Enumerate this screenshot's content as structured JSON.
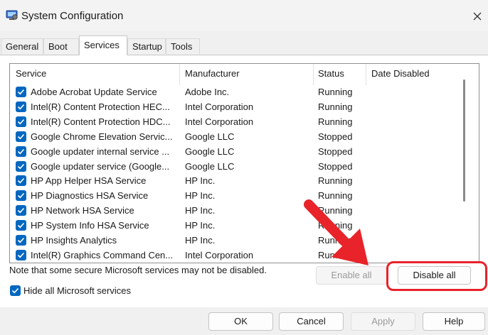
{
  "window": {
    "title": "System Configuration",
    "app_icon": "msconfig-icon",
    "close_icon": "close-icon"
  },
  "tabs": [
    {
      "label": "General",
      "active": false
    },
    {
      "label": "Boot",
      "active": false
    },
    {
      "label": "Services",
      "active": true
    },
    {
      "label": "Startup",
      "active": false
    },
    {
      "label": "Tools",
      "active": false
    }
  ],
  "services": {
    "columns": [
      "Service",
      "Manufacturer",
      "Status",
      "Date Disabled"
    ],
    "rows": [
      {
        "service": "Adobe Acrobat Update Service",
        "manufacturer": "Adobe Inc.",
        "status": "Running",
        "checked": true
      },
      {
        "service": "Intel(R) Content Protection HEC...",
        "manufacturer": "Intel Corporation",
        "status": "Running",
        "checked": true
      },
      {
        "service": "Intel(R) Content Protection HDC...",
        "manufacturer": "Intel Corporation",
        "status": "Running",
        "checked": true
      },
      {
        "service": "Google Chrome Elevation Servic...",
        "manufacturer": "Google LLC",
        "status": "Stopped",
        "checked": true
      },
      {
        "service": "Google updater internal service ...",
        "manufacturer": "Google LLC",
        "status": "Stopped",
        "checked": true
      },
      {
        "service": "Google updater service (Google...",
        "manufacturer": "Google LLC",
        "status": "Stopped",
        "checked": true
      },
      {
        "service": "HP App Helper HSA Service",
        "manufacturer": "HP Inc.",
        "status": "Running",
        "checked": true
      },
      {
        "service": "HP Diagnostics HSA Service",
        "manufacturer": "HP Inc.",
        "status": "Running",
        "checked": true
      },
      {
        "service": "HP Network HSA Service",
        "manufacturer": "HP Inc.",
        "status": "Running",
        "checked": true
      },
      {
        "service": "HP System Info HSA Service",
        "manufacturer": "HP Inc.",
        "status": "Running",
        "checked": true
      },
      {
        "service": "HP Insights Analytics",
        "manufacturer": "HP Inc.",
        "status": "Running",
        "checked": true
      },
      {
        "service": "Intel(R) Graphics Command Cen...",
        "manufacturer": "Intel Corporation",
        "status": "Running",
        "checked": true
      }
    ]
  },
  "note": "Note that some secure Microsoft services may not be disabled.",
  "buttons": {
    "enable_all": "Enable all",
    "disable_all": "Disable all",
    "ok": "OK",
    "cancel": "Cancel",
    "apply": "Apply",
    "help": "Help"
  },
  "hide_ms": {
    "label": "Hide all Microsoft services",
    "checked": true
  },
  "colors": {
    "accent": "#0067c0",
    "annotation": "#e8232a"
  }
}
